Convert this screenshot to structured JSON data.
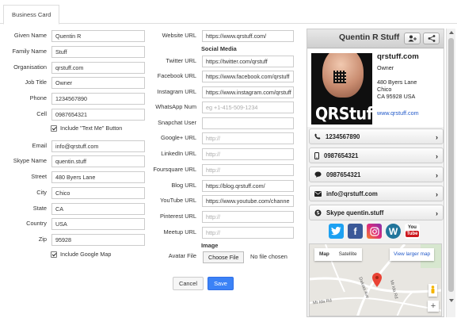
{
  "tab": "Business Card",
  "col1": [
    {
      "name": "given-name",
      "label": "Given Name",
      "value": "Quentin R"
    },
    {
      "name": "family-name",
      "label": "Family Name",
      "value": "Stuff"
    },
    {
      "name": "organisation",
      "label": "Organisation",
      "value": "qrstuff.com"
    },
    {
      "name": "job-title",
      "label": "Job Title",
      "value": "Owner"
    },
    {
      "name": "phone",
      "label": "Phone",
      "value": "1234567890"
    },
    {
      "name": "cell",
      "label": "Cell",
      "value": "0987654321"
    }
  ],
  "text_me_label": "Include \"Text Me\" Button",
  "col1b": [
    {
      "name": "email",
      "label": "Email",
      "value": "info@qrstuff.com"
    },
    {
      "name": "skype-name",
      "label": "Skype Name",
      "value": "quentin.stuff"
    },
    {
      "name": "street",
      "label": "Street",
      "value": "480 Byers Lane"
    },
    {
      "name": "city",
      "label": "City",
      "value": "Chico"
    },
    {
      "name": "state",
      "label": "State",
      "value": "CA"
    },
    {
      "name": "country",
      "label": "Country",
      "value": "USA"
    },
    {
      "name": "zip",
      "label": "Zip",
      "value": "95928"
    }
  ],
  "google_map_label": "Include Google Map",
  "website": {
    "label": "Website URL",
    "value": "https://www.qrstuff.com/"
  },
  "social_heading": "Social Media",
  "col2": [
    {
      "name": "twitter-url",
      "label": "Twitter URL",
      "value": "https://twitter.com/qrstuff",
      "placeholder": ""
    },
    {
      "name": "facebook-url",
      "label": "Facebook URL",
      "value": "https://www.facebook.com/qrstuff",
      "placeholder": ""
    },
    {
      "name": "instagram-url",
      "label": "Instagram URL",
      "value": "https://www.instagram.com/qrstuff",
      "placeholder": ""
    },
    {
      "name": "whatsapp-num",
      "label": "WhatsApp Num",
      "value": "",
      "placeholder": "eg +1-415-509-1234"
    },
    {
      "name": "snapchat-user",
      "label": "Snapchat User",
      "value": "",
      "placeholder": ""
    },
    {
      "name": "googleplus-url",
      "label": "Google+ URL",
      "value": "",
      "placeholder": "http://"
    },
    {
      "name": "linkedin-url",
      "label": "LinkedIn URL",
      "value": "",
      "placeholder": "http://"
    },
    {
      "name": "foursquare-url",
      "label": "Foursquare URL",
      "value": "",
      "placeholder": "http://"
    },
    {
      "name": "blog-url",
      "label": "Blog URL",
      "value": "https://blog.qrstuff.com/",
      "placeholder": ""
    },
    {
      "name": "youtube-url",
      "label": "YouTube URL",
      "value": "https://www.youtube.com/channe",
      "placeholder": ""
    },
    {
      "name": "pinterest-url",
      "label": "Pinterest URL",
      "value": "",
      "placeholder": "http://"
    },
    {
      "name": "meetup-url",
      "label": "Meetup URL",
      "value": "",
      "placeholder": "http://"
    }
  ],
  "image_heading": "Image",
  "avatar_label": "Avatar File",
  "choose_file": "Choose File",
  "no_file": "No file chosen",
  "cancel": "Cancel",
  "save": "Save",
  "preview": {
    "name": "Quentin R Stuff",
    "org": "qrstuff.com",
    "title": "Owner",
    "addr1": "480 Byers Lane",
    "addr2": "Chico",
    "addr3": "CA 95928 USA",
    "web": "www.qrstuff.com",
    "photo_word": "QRStuff",
    "rows": [
      {
        "name": "phone",
        "icon": "phone-icon",
        "text": "1234567890"
      },
      {
        "name": "cell",
        "icon": "mobile-icon",
        "text": "0987654321"
      },
      {
        "name": "sms",
        "icon": "chat-icon",
        "text": "0987654321"
      },
      {
        "name": "email",
        "icon": "mail-icon",
        "text": "info@qrstuff.com"
      },
      {
        "name": "skype",
        "icon": "skype-icon",
        "text": "Skype quentin.stuff"
      }
    ],
    "map_tabs": [
      "Map",
      "Satellite"
    ],
    "map_link": "View larger map",
    "streets": [
      "Dakota Ave",
      "Mt Ida Rd",
      "Mt Ida Rd"
    ]
  },
  "colors": {
    "save": "#3b82f6",
    "link": "#2159c9",
    "twitter": "#1da1f2",
    "facebook": "#3b5998",
    "instagram": "#c13584",
    "wordpress": "#21759b",
    "youtube": "#cc181e",
    "pin": "#ea4335"
  }
}
